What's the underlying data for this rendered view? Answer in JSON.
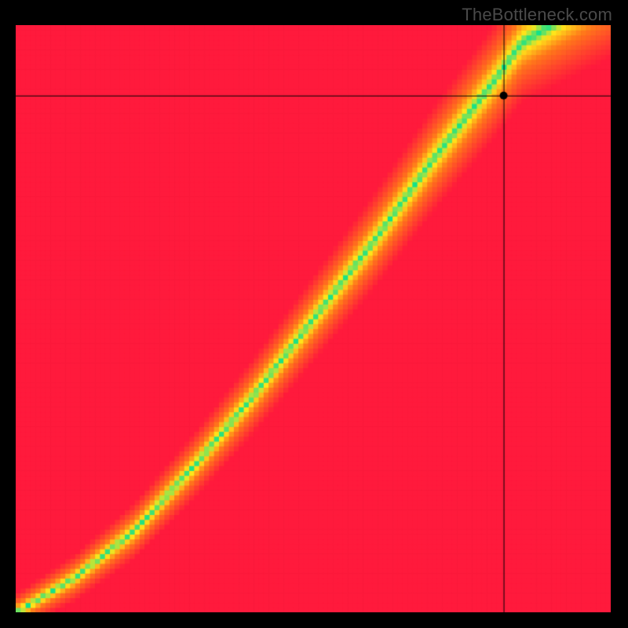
{
  "watermark": "TheBottleneck.com",
  "chart_data": {
    "type": "heatmap",
    "title": "",
    "xlabel": "",
    "ylabel": "",
    "xlim": [
      0,
      100
    ],
    "ylim": [
      0,
      100
    ],
    "grid_resolution": 120,
    "colormap_description": "Red (worst) → Orange → Yellow → Green (balanced) → Yellow → Orange → Red; green ridge marks balanced CPU/GPU pairing",
    "colormap_stops": [
      {
        "t": -1.0,
        "color": "#ff1a3c"
      },
      {
        "t": -0.5,
        "color": "#ff7a1a"
      },
      {
        "t": -0.2,
        "color": "#ffe61a"
      },
      {
        "t": 0.0,
        "color": "#13e28a"
      },
      {
        "t": 0.2,
        "color": "#ffe61a"
      },
      {
        "t": 0.5,
        "color": "#ff7a1a"
      },
      {
        "t": 1.0,
        "color": "#ff1a3c"
      }
    ],
    "balanced_ridge": {
      "description": "Approximate y (GPU score) required for balance at given x (CPU score), normalized 0–100",
      "points": [
        {
          "x": 0,
          "y": 0
        },
        {
          "x": 10,
          "y": 6
        },
        {
          "x": 20,
          "y": 14
        },
        {
          "x": 30,
          "y": 25
        },
        {
          "x": 40,
          "y": 37
        },
        {
          "x": 50,
          "y": 50
        },
        {
          "x": 60,
          "y": 63
        },
        {
          "x": 70,
          "y": 77
        },
        {
          "x": 80,
          "y": 90
        },
        {
          "x": 85,
          "y": 97
        },
        {
          "x": 90,
          "y": 100
        }
      ],
      "half_width_pct": 6
    },
    "crosshair": {
      "x_pct": 82,
      "y_pct": 88,
      "marker": "dot",
      "color": "#000000"
    }
  }
}
